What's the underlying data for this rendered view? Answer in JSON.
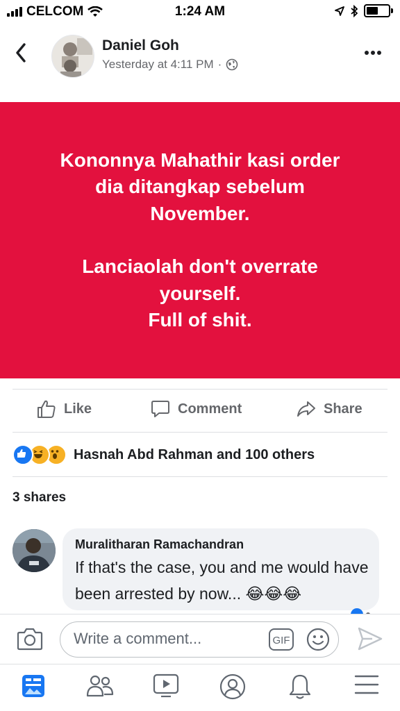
{
  "status_bar": {
    "carrier": "CELCOM",
    "time": "1:24 AM"
  },
  "post": {
    "author": "Daniel Goh",
    "timestamp": "Yesterday at 4:11 PM",
    "separator": "·",
    "background_color": "#e3113e",
    "text_lines_1": [
      "Kononnya Mahathir kasi order",
      "dia ditangkap sebelum",
      "November."
    ],
    "text_lines_2": [
      "Lanciaolah don't overrate",
      "yourself.",
      "Full of shit."
    ]
  },
  "actions": {
    "like": "Like",
    "comment": "Comment",
    "share": "Share"
  },
  "reactions": {
    "summary": "Hasnah Abd Rahman and 100 others",
    "icons": [
      "like-icon",
      "laugh-icon",
      "wow-icon"
    ]
  },
  "shares_label": "3 shares",
  "comment": {
    "name": "Muralitharan Ramachandran",
    "text": "If that's the case, you and me would have been arrested by now... 😂😂😂"
  },
  "composer": {
    "placeholder": "Write a comment...",
    "gif_label": "GIF"
  },
  "tabbar": {
    "items": [
      "news-feed-icon",
      "friends-icon",
      "watch-icon",
      "profile-icon",
      "notifications-icon",
      "menu-icon"
    ]
  },
  "colors": {
    "accent": "#1877f2",
    "secondary_text": "#65676b",
    "post_bg": "#e3113e"
  }
}
